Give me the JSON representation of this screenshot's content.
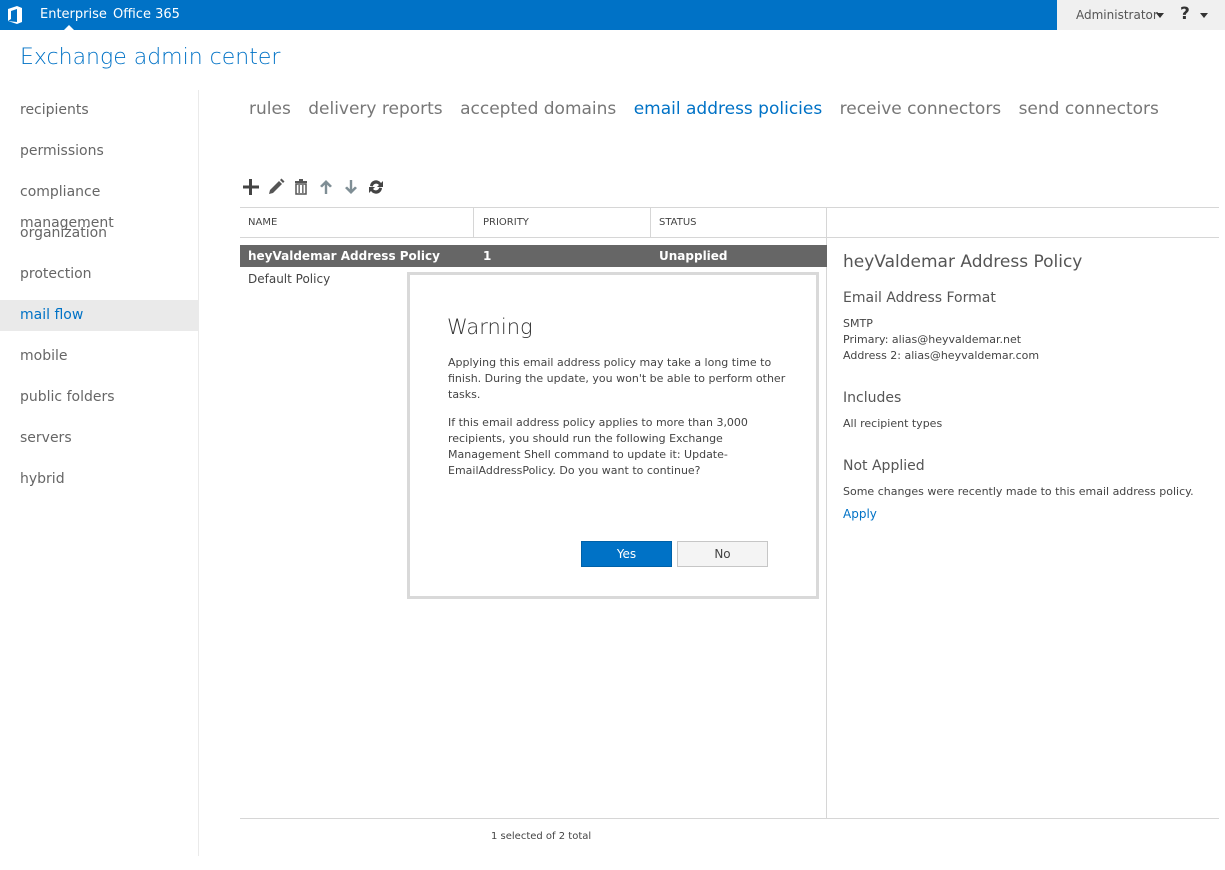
{
  "topbar": {
    "nav": [
      "Enterprise",
      "Office 365"
    ],
    "user": "Administrator",
    "help_label": "?"
  },
  "app_title": "Exchange admin center",
  "sidebar": {
    "items": [
      {
        "label": "recipients",
        "active": false
      },
      {
        "label": "permissions",
        "active": false
      },
      {
        "label": "compliance management",
        "active": false
      },
      {
        "label": "organization",
        "active": false
      },
      {
        "label": "protection",
        "active": false
      },
      {
        "label": "mail flow",
        "active": true
      },
      {
        "label": "mobile",
        "active": false
      },
      {
        "label": "public folders",
        "active": false
      },
      {
        "label": "servers",
        "active": false
      },
      {
        "label": "hybrid",
        "active": false
      }
    ]
  },
  "tabs": [
    {
      "label": "rules",
      "active": false
    },
    {
      "label": "delivery reports",
      "active": false
    },
    {
      "label": "accepted domains",
      "active": false
    },
    {
      "label": "email address policies",
      "active": true
    },
    {
      "label": "receive connectors",
      "active": false
    },
    {
      "label": "send connectors",
      "active": false
    }
  ],
  "toolbar": {
    "icons": [
      "add-icon",
      "edit-icon",
      "delete-icon",
      "move-up-icon",
      "move-down-icon",
      "refresh-icon"
    ]
  },
  "table": {
    "columns": [
      "NAME",
      "PRIORITY",
      "STATUS"
    ],
    "rows": [
      {
        "name": "heyValdemar Address Policy",
        "priority": "1",
        "status": "Unapplied",
        "selected": true
      },
      {
        "name": "Default Policy",
        "priority": "",
        "status": "",
        "selected": false
      }
    ],
    "footer": "1 selected of 2 total"
  },
  "details": {
    "title": "heyValdemar Address Policy",
    "format_heading": "Email Address Format",
    "format_type": "SMTP",
    "primary": "Primary: alias@heyvaldemar.net",
    "address2": "Address 2: alias@heyvaldemar.com",
    "includes_heading": "Includes",
    "includes_value": "All recipient types",
    "status_heading": "Not Applied",
    "status_text": "Some changes were recently made to this email address policy.",
    "apply_link": "Apply"
  },
  "dialog": {
    "title": "Warning",
    "paragraph1": "Applying this email address policy may take a long time to finish. During the update, you won't be able to perform other tasks.",
    "paragraph2": "If this email address policy applies to more than 3,000 recipients, you should run the following Exchange Management Shell command to update it: Update-EmailAddressPolicy. Do you want to continue?",
    "yes_label": "Yes",
    "no_label": "No"
  },
  "colors": {
    "brand": "#0072c6",
    "selected_row": "#666666",
    "active_nav_bg": "#eaeaea"
  }
}
